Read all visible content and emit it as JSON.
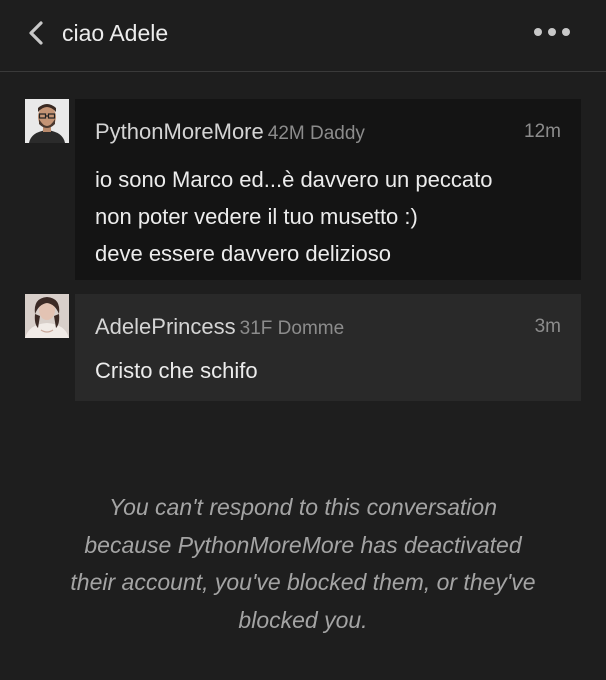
{
  "header": {
    "back_icon": "chevron-left-icon",
    "title": "ciao Adele",
    "more_icon": "more-horizontal-icon"
  },
  "messages": [
    {
      "avatar": "user-photo-man-glasses",
      "sender": "PythonMoreMore",
      "meta": "42M Daddy",
      "time": "12m",
      "lines": [
        "io sono Marco ed...è davvero un peccato",
        "non poter vedere il tuo musetto :)",
        "deve essere davvero delizioso"
      ]
    },
    {
      "avatar": "user-photo-woman",
      "sender": "AdelePrincess",
      "meta": "31F Domme",
      "time": "3m",
      "lines": [
        "Cristo che schifo"
      ]
    }
  ],
  "notice": {
    "lines": [
      "You can't respond to this conversation",
      "because PythonMoreMore has deactivated",
      "their account, you've blocked them, or they've",
      "blocked you."
    ]
  },
  "colors": {
    "background": "#1e1e1e",
    "incoming_bubble": "#141414",
    "outgoing_bubble": "#292929",
    "text": "#ececec",
    "muted": "#8c8c8c"
  }
}
